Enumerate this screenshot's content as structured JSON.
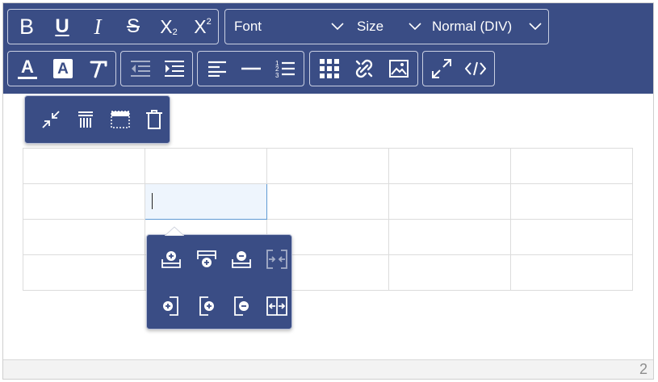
{
  "toolbar": {
    "row1": {
      "format_buttons": [
        {
          "label": "B",
          "name": "bold-button"
        },
        {
          "label": "U",
          "name": "underline-button"
        },
        {
          "label": "I",
          "name": "italic-button"
        },
        {
          "label": "S",
          "name": "strikethrough-button"
        }
      ],
      "subscript": {
        "base": "X",
        "sub": "2"
      },
      "superscript": {
        "base": "X",
        "sup": "2"
      },
      "font_select": "Font",
      "size_select": "Size",
      "block_select": "Normal (DIV)"
    },
    "row2": {
      "font_color_label": "A",
      "background_color_label": "A"
    },
    "icons": [
      "font-color-icon",
      "background-color-icon",
      "clear-format-icon",
      "outdent-icon",
      "indent-icon",
      "align-left-icon",
      "horizontal-rule-icon",
      "ordered-list-icon",
      "table-icon",
      "unlink-icon",
      "image-icon",
      "fullscreen-icon",
      "source-code-icon"
    ]
  },
  "table_toolbar": {
    "icons": [
      "shrink-table-icon",
      "table-style-icon",
      "table-border-icon",
      "delete-table-icon"
    ]
  },
  "cell_toolbar": {
    "icons": [
      "insert-row-above-icon",
      "insert-row-below-icon",
      "delete-row-icon",
      "merge-cells-icon",
      "insert-column-left-icon",
      "insert-column-right-icon",
      "delete-column-icon",
      "split-cell-icon"
    ]
  },
  "table": {
    "rows": 4,
    "columns": 5,
    "active_cell": {
      "row": 2,
      "column": 2
    }
  },
  "status_bar": {
    "character_count": "2"
  },
  "colors": {
    "toolbar_bg": "#3a4d85",
    "icon": "#ffffff",
    "active_cell_bg": "#eef5fd",
    "active_cell_border": "#5f9ad3"
  }
}
